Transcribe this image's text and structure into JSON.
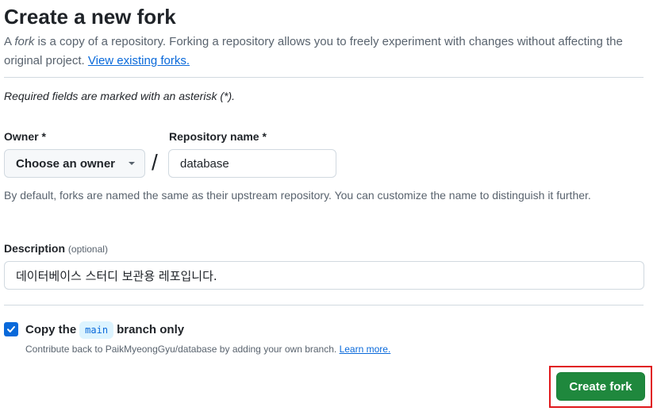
{
  "header": {
    "title": "Create a new fork",
    "subtitle_pre": "A ",
    "subtitle_em": "fork",
    "subtitle_post": " is a copy of a repository. Forking a repository allows you to freely experiment with changes without affecting the original project. ",
    "view_forks_link": "View existing forks."
  },
  "form": {
    "required_note": "Required fields are marked with an asterisk (*).",
    "owner_label": "Owner *",
    "owner_button": "Choose an owner",
    "separator": "/",
    "repo_label": "Repository name *",
    "repo_value": "database",
    "repo_hint": "By default, forks are named the same as their upstream repository. You can customize the name to distinguish it further.",
    "description_label": "Description",
    "description_optional": "(optional)",
    "description_value": "데이터베이스 스터디 보관용 레포입니다.",
    "copy_checked": true,
    "copy_pre": "Copy the",
    "copy_branch": "main",
    "copy_post": "branch only",
    "contrib_text": "Contribute back to PaikMyeongGyu/database by adding your own branch. ",
    "learn_more": "Learn more.",
    "submit_label": "Create fork"
  },
  "colors": {
    "primary_button": "#1f883d",
    "link": "#0969da",
    "highlight": "#e0171b"
  }
}
